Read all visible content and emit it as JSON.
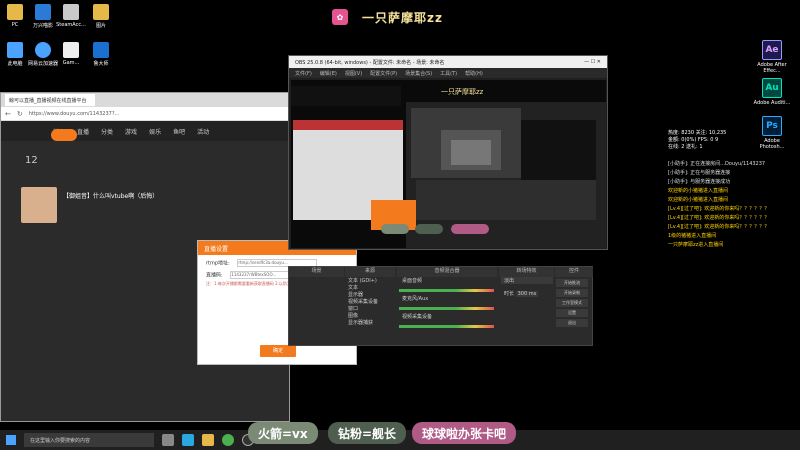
{
  "stream": {
    "title": "一只萨摩耶zz"
  },
  "desktop_icons_left": [
    {
      "label": "PC",
      "color": "#e6b84a"
    },
    {
      "label": "万兴喵影",
      "color": "#2b7bd6"
    },
    {
      "label": "SteamAcc...",
      "color": "#c9c9c9"
    },
    {
      "label": "图片",
      "color": "#e6b84a"
    },
    {
      "label": "此电脑",
      "color": "#4aa3ff"
    },
    {
      "label": "网易云加速器",
      "color": "#4aa3ff"
    },
    {
      "label": "Gam...",
      "color": "#eee"
    },
    {
      "label": "鲁大师",
      "color": "#1b6fd1"
    }
  ],
  "desktop_icons_right": [
    {
      "abbr": "Ae",
      "label": "Adobe After Effec...",
      "color": "#1f1a4d"
    },
    {
      "abbr": "Au",
      "label": "Adobe Auditi...",
      "color": "#00473f"
    },
    {
      "abbr": "Ps",
      "label": "Adobe Photosh...",
      "color": "#001e36"
    }
  ],
  "browser": {
    "tab": "鲸可以直播_直播视频在线直播平台",
    "url": "https://www.douyu.com/1143237?...",
    "nav": [
      "首页",
      "直播",
      "分类",
      "游戏",
      "娱乐",
      "鱼吧",
      "活动"
    ],
    "stat": "12",
    "room_title": "【御姐音】什么叫vtube啊（后悔）"
  },
  "dialog": {
    "title": "直播设置",
    "rtmp_label": "rtmp地址:",
    "rtmp_value": "rtmp://sendfc3a.douyu...",
    "code_label": "直播码:",
    "code_value": "1143237rWBtexSOO...",
    "notes": "注：1.每次开播都需要重新获取直播码  2.以防为直播码泄露造成损失",
    "confirm": "确定"
  },
  "obs": {
    "title": "OBS 25.0.8 (64-bit, windows) - 配置文件: 未命名 - 场景: 未命名",
    "menu": [
      "文件(F)",
      "编辑(E)",
      "视图(V)",
      "配置文件(P)",
      "场景集合(S)",
      "工具(T)",
      "帮助(H)"
    ]
  },
  "mixer": {
    "scenes_head": "场景",
    "sources_head": "来源",
    "audio_head": "音频混合器",
    "transition_head": "转场特效",
    "controls_head": "控件",
    "sources": [
      "文本 (GDI+)",
      "文本",
      "显示器",
      "视频采集设备",
      "窗口",
      "图像",
      "显示器捕获"
    ],
    "audio": [
      "桌面音频",
      "麦克风/Aux",
      "视频采集设备"
    ],
    "transition_value": "淡出",
    "duration_label": "时长",
    "duration_value": "300 ms",
    "controls": [
      "开始推流",
      "开始录制",
      "工作室模式",
      "设置",
      "退出"
    ]
  },
  "stats": {
    "line1": "热度:  8230    关注:  10,235",
    "line2": "金额:  0(0%)    FPS:  0     9",
    "line3": "在线:  2         送礼:  1"
  },
  "chat": [
    {
      "type": "sys",
      "text": "[小助手]: 正在连接房间...Douyu/1143237"
    },
    {
      "type": "sys",
      "text": "[小助手]: 正在与服务器连接"
    },
    {
      "type": "sys",
      "text": "[小助手]: 与服务器连接成功"
    },
    {
      "type": "msg",
      "text": "欢迎新的小猪猪进入直播间"
    },
    {
      "type": "msg",
      "text": "欢迎新的小猪猪进入直播间"
    },
    {
      "type": "msg",
      "text": "[Lv.4][过了吧]: 欢迎新的你来吗？？？？？？"
    },
    {
      "type": "msg",
      "text": "[Lv.4][过了吧]: 欢迎新的你来吗？？？？？？"
    },
    {
      "type": "msg",
      "text": "[Lv.4][过了吧]: 欢迎新的你来吗？？？？？？"
    },
    {
      "type": "msg",
      "text": "1级的猪猪进入直播间"
    },
    {
      "type": "msg",
      "text": "一只萨摩耶zz进入直播间"
    }
  ],
  "badges": {
    "rocket": "火箭=vx",
    "diamond": "钻粉=舰长",
    "card": "球球啦办张卡吧"
  },
  "taskbar": {
    "search_placeholder": "在这里输入你要搜索的内容"
  }
}
